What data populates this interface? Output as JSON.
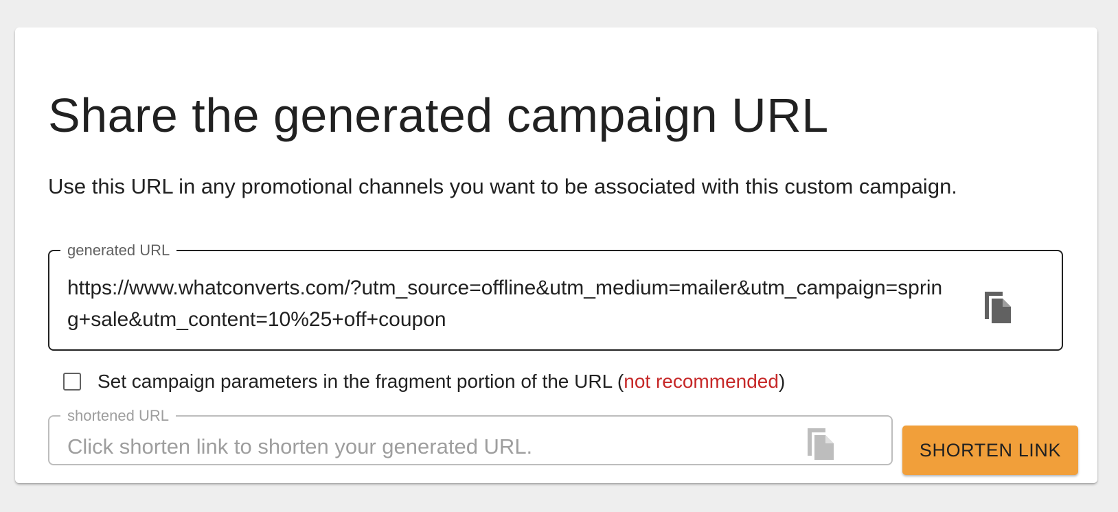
{
  "card": {
    "title": "Share the generated campaign URL",
    "subtitle": "Use this URL in any promotional channels you want to be associated with this custom campaign."
  },
  "generated_url": {
    "label": "generated URL",
    "value": "https://www.whatconverts.com/?utm_source=offline&utm_medium=mailer&utm_campaign=spring+sale&utm_content=10%25+off+coupon",
    "copy_icon": "copy-icon"
  },
  "fragment_option": {
    "label": "Set campaign parameters in the fragment portion of the URL (",
    "warning": "not recommended",
    "suffix": ")",
    "checked": false
  },
  "shortened_url": {
    "label": "shortened URL",
    "placeholder": "Click shorten link to shorten your generated URL.",
    "value": "",
    "copy_icon": "copy-icon"
  },
  "actions": {
    "shorten_label": "SHORTEN LINK"
  },
  "colors": {
    "background": "#eeeeee",
    "accent": "#f19f3a",
    "warning": "#c62828"
  }
}
